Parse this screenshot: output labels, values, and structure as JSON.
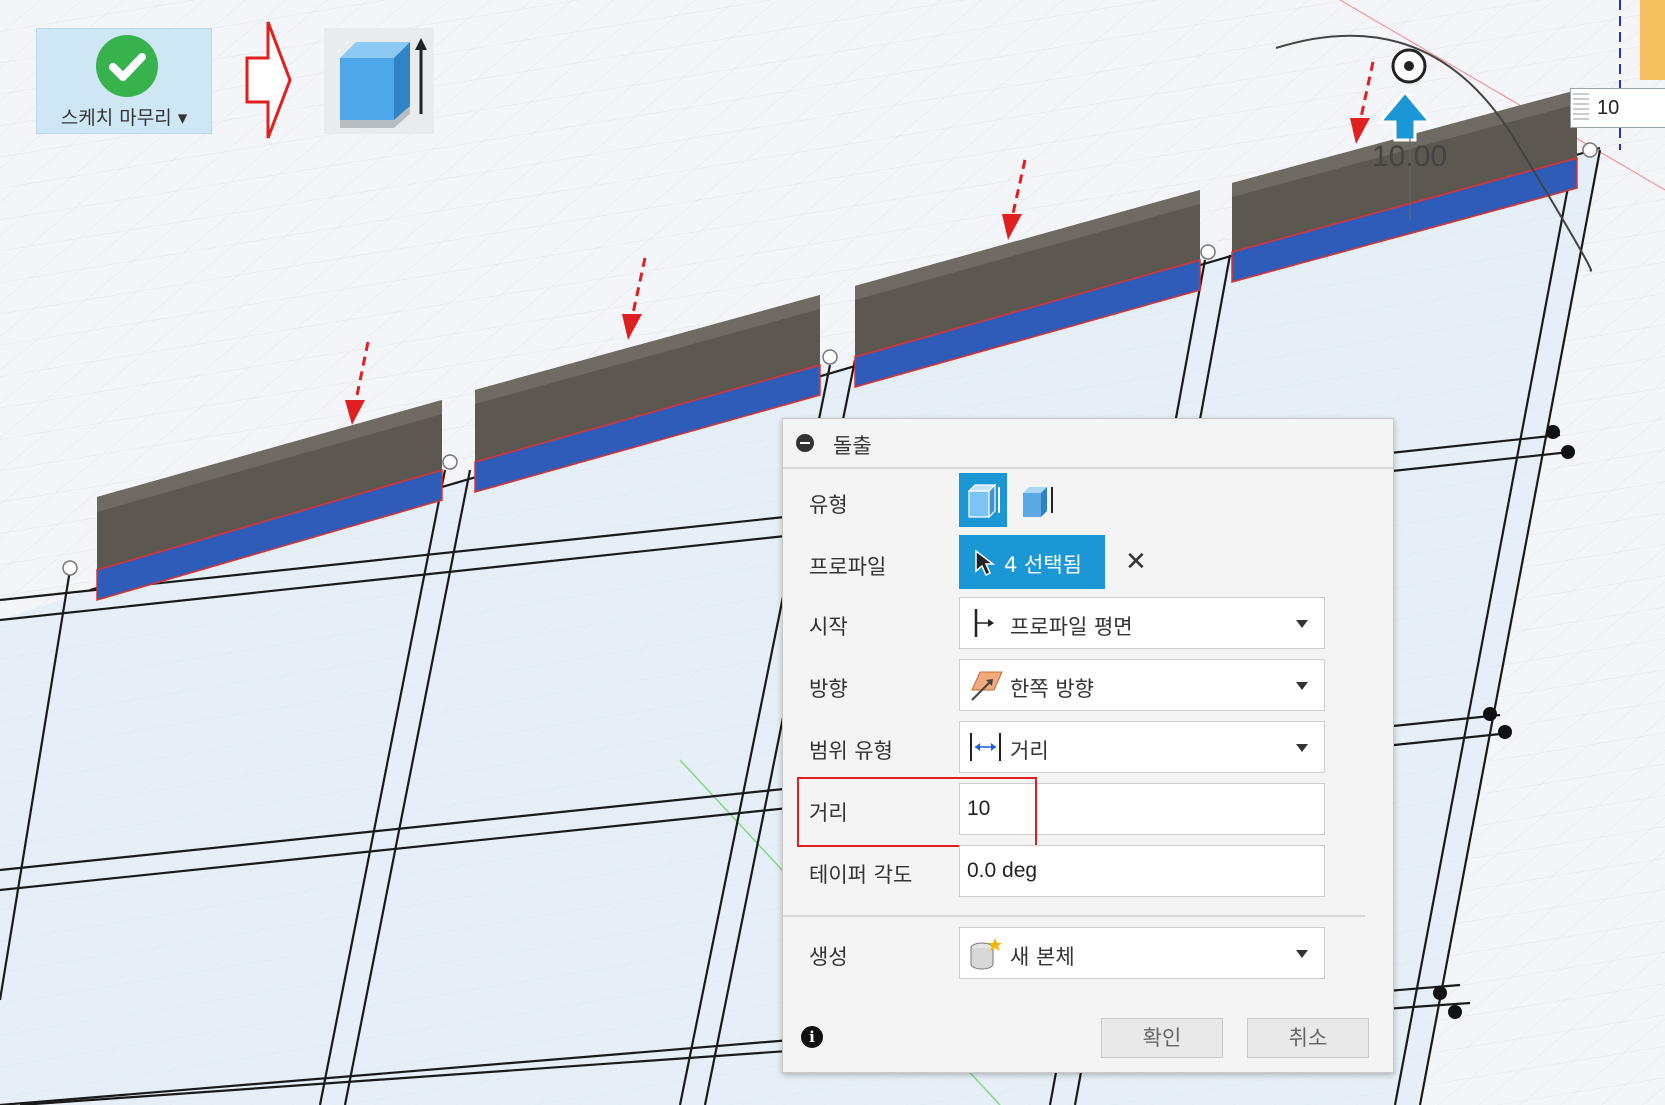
{
  "toolbar": {
    "finish_sketch_label": "스케치 마무리 ▾"
  },
  "viewport": {
    "dimension_input_value": "10",
    "dimension_label": "10.00"
  },
  "dialog": {
    "title": "돌출",
    "rows": {
      "type_label": "유형",
      "profile_label": "프로파일",
      "profile_selected": "4 선택됨",
      "start_label": "시작",
      "start_value": "프로파일 평면",
      "direction_label": "방향",
      "direction_value": "한쪽 방향",
      "extent_type_label": "범위 유형",
      "extent_type_value": "거리",
      "distance_label": "거리",
      "distance_value": "10",
      "taper_label": "테이퍼 각도",
      "taper_value": "0.0 deg",
      "create_label": "생성",
      "create_value": "새 본체"
    },
    "ok_label": "확인",
    "cancel_label": "취소"
  },
  "colors": {
    "accent": "#1c97d6",
    "check_green": "#37b24d",
    "annotation_red": "#e02020",
    "profile_blue": "#2f5cb8",
    "body_dark": "#5a5550"
  }
}
